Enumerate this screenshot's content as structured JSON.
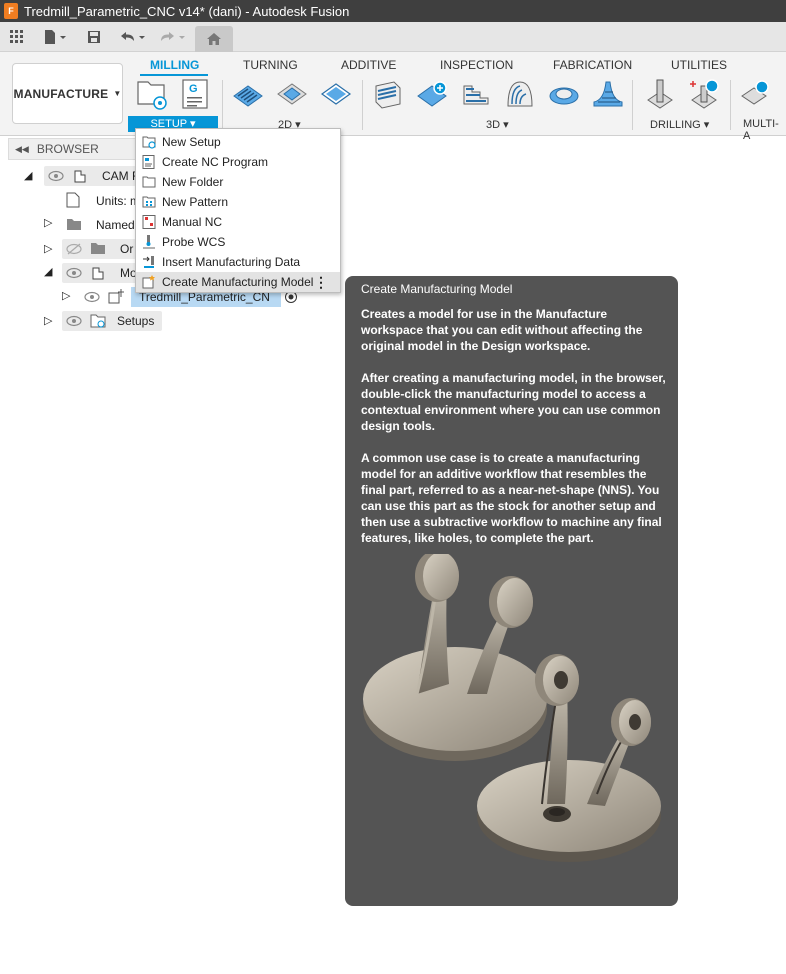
{
  "window": {
    "title": "Tredmill_Parametric_CNC v14* (dani) - Autodesk Fusion"
  },
  "workspace": {
    "label": "MANUFACTURE"
  },
  "tabs": [
    {
      "label": "MILLING"
    },
    {
      "label": "TURNING"
    },
    {
      "label": "ADDITIVE"
    },
    {
      "label": "INSPECTION"
    },
    {
      "label": "FABRICATION"
    },
    {
      "label": "UTILITIES"
    }
  ],
  "groups": {
    "setup": "SETUP",
    "twod": "2D",
    "threed": "3D",
    "drilling": "DRILLING",
    "multiaxis": "MULTI-A"
  },
  "nc_icon_letter": "G",
  "browser": {
    "header": "BROWSER",
    "nodes": [
      {
        "label": "CAM F"
      },
      {
        "label": "Units: m"
      },
      {
        "label": "Named"
      },
      {
        "label": "Or"
      },
      {
        "label": "Mo"
      },
      {
        "label": "Tredmill_Parametric_CN"
      },
      {
        "label": "Setups"
      }
    ]
  },
  "menu": {
    "items": [
      {
        "label": "New Setup"
      },
      {
        "label": "Create NC Program"
      },
      {
        "label": "New Folder"
      },
      {
        "label": "New Pattern"
      },
      {
        "label": "Manual NC"
      },
      {
        "label": "Probe WCS"
      },
      {
        "label": "Insert Manufacturing Data"
      },
      {
        "label": "Create Manufacturing Model"
      }
    ]
  },
  "tooltip": {
    "title": "Create Manufacturing Model",
    "p1": "Creates a model for use in the Manufacture workspace that you can edit without affecting the original model in the Design workspace.",
    "p2": "After creating a manufacturing model, in the browser, double-click the manufacturing model to access a contextual environment where you can use common design tools.",
    "p3": "A common use case is to create a manufacturing model for an additive workflow that resembles the final part, referred to as a near-net-shape (NNS). You can use this part as the stock for another setup and then use a subtractive workflow to machine any final features, like holes, to complete the part."
  },
  "colors": {
    "accent": "#0696d7",
    "titlebar": "#3f3f3f",
    "tooltip_bg": "#545454"
  }
}
